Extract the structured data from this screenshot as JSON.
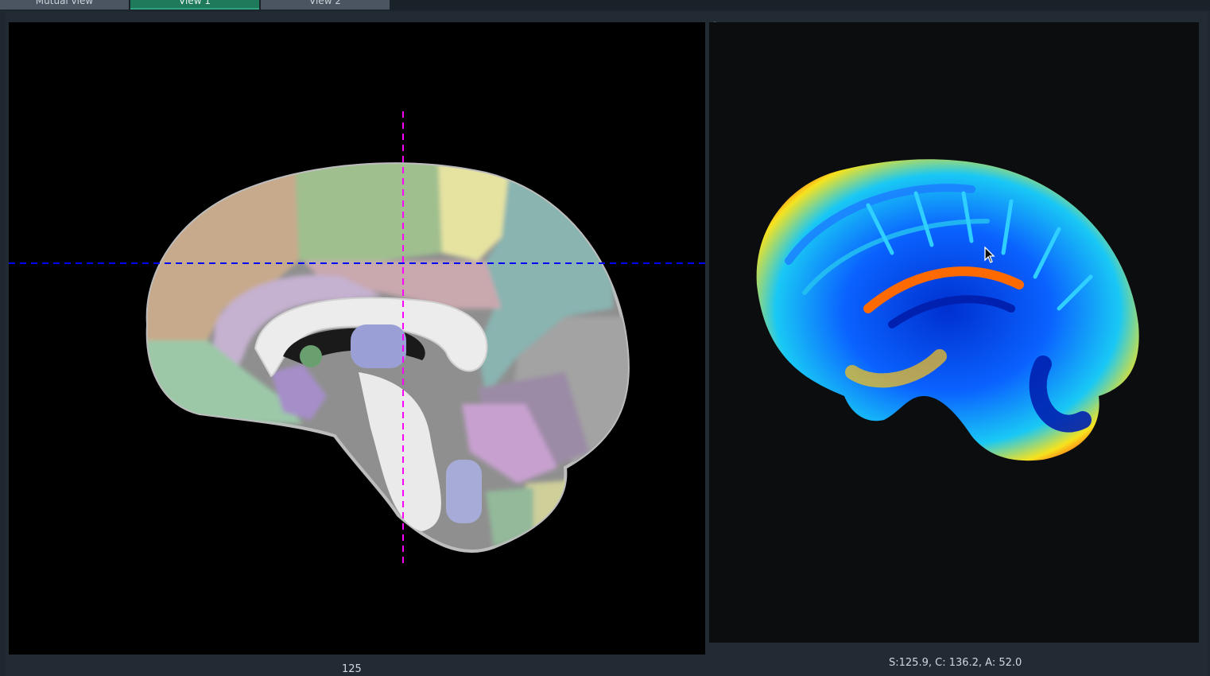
{
  "tabs": [
    {
      "label": "Mutual view",
      "active": false
    },
    {
      "label": "View 1",
      "active": true
    },
    {
      "label": "View 2",
      "active": false
    }
  ],
  "viewer2d": {
    "slice_index": "125",
    "crosshair_colors": {
      "vertical": "#ff00ff",
      "horizontal": "#0000ff"
    },
    "regions": [
      "frontal-tan",
      "precentral-green",
      "parietal-yellow",
      "parieto-occipital-teal",
      "cingulate-pink",
      "cingulate-lavender",
      "orbitofrontal-mint",
      "thalamus-blue",
      "cerebellum-violet",
      "brainstem-blue",
      "cerebellum-green",
      "cerebellum-olive"
    ]
  },
  "viewer3d": {
    "coordinates": "S:125.9, C: 136.2, A: 52.0",
    "colormap": "jet"
  },
  "colors": {
    "active_tab": "#1e7a5a",
    "inactive_tab": "#4a5561",
    "background": "#1f2830"
  }
}
